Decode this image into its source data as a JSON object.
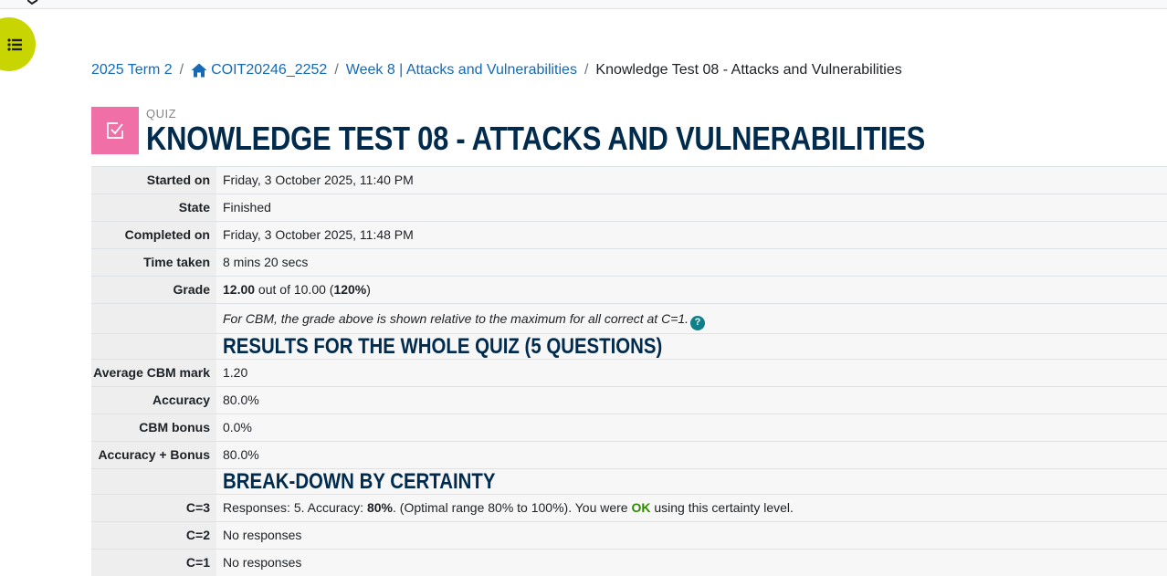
{
  "breadcrumb": {
    "term": "2025 Term 2",
    "course": "COIT20246_2252",
    "week": "Week 8 | Attacks and Vulnerabilities",
    "current": "Knowledge Test 08 - Attacks and Vulnerabilities",
    "separator": "/"
  },
  "page": {
    "kicker": "QUIZ",
    "title": "KNOWLEDGE TEST 08 - ATTACKS AND VULNERABILITIES",
    "icon_color": "#ef6fa6"
  },
  "summary": {
    "started_label": "Started on",
    "started_value": "Friday, 3 October 2025, 11:40 PM",
    "state_label": "State",
    "state_value": "Finished",
    "completed_label": "Completed on",
    "completed_value": "Friday, 3 October 2025, 11:48 PM",
    "time_label": "Time taken",
    "time_value": "8 mins 20 secs",
    "grade_label": "Grade",
    "grade_score": "12.00",
    "grade_out_of": " out of 10.00 (",
    "grade_percent": "120%",
    "grade_close": ")",
    "cbm_note": "For CBM, the grade above is shown relative to the maximum for all correct at C=1.",
    "help_glyph": "?"
  },
  "results": {
    "heading": "RESULTS FOR THE WHOLE QUIZ (5 QUESTIONS)",
    "avg_cbm_label": "Average CBM mark",
    "avg_cbm_value": "1.20",
    "accuracy_label": "Accuracy",
    "accuracy_value": "80.0%",
    "cbm_bonus_label": "CBM bonus",
    "cbm_bonus_value": "0.0%",
    "acc_bonus_label": "Accuracy + Bonus",
    "acc_bonus_value": "80.0%"
  },
  "breakdown": {
    "heading": "BREAK-DOWN BY CERTAINTY",
    "c3_label": "C=3",
    "c3_pre": "Responses: 5. Accuracy: ",
    "c3_acc": "80%",
    "c3_mid": ". (Optimal range 80% to 100%). You were ",
    "c3_ok": "OK",
    "c3_post": " using this certainty level.",
    "c2_label": "C=2",
    "c2_value": "No responses",
    "c1_label": "C=1",
    "c1_value": "No responses"
  },
  "colors": {
    "link": "#1769b4",
    "heading": "#002b4d",
    "drawer_button": "#c9d500",
    "ok": "#2e8b00",
    "help": "#0f7f8a"
  },
  "icons": {
    "drawer": "list-icon",
    "home": "home-icon",
    "quiz": "quiz-checkbox-icon",
    "help": "help-icon"
  }
}
